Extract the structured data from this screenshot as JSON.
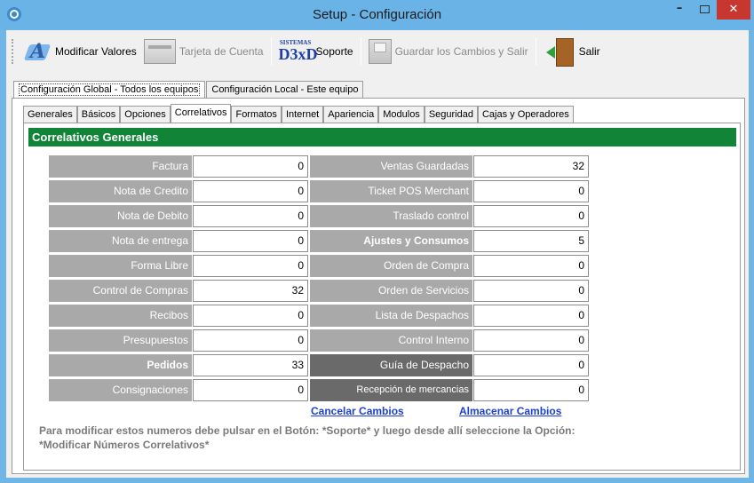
{
  "window": {
    "title": "Setup - Configuración",
    "controls": {
      "minimize": "–",
      "maximize": "",
      "close": "✕"
    }
  },
  "toolbar": {
    "modify_label": "Modificar Valores",
    "card_label": "Tarjeta de Cuenta",
    "support_logo_top": "SISTEMAS",
    "support_logo_main": "D3xD",
    "support_label": "Soporte",
    "save_label": "Guardar los Cambios  y Salir",
    "exit_label": "Salir"
  },
  "outer_tabs": [
    {
      "label": "Configuración Global - Todos los equipos",
      "active": true
    },
    {
      "label": "Configuración Local - Este equipo",
      "active": false
    }
  ],
  "inner_tabs": [
    {
      "label": "Generales",
      "active": false
    },
    {
      "label": "Básicos",
      "active": false
    },
    {
      "label": "Opciones",
      "active": false
    },
    {
      "label": "Correlativos",
      "active": true
    },
    {
      "label": "Formatos",
      "active": false
    },
    {
      "label": "Internet",
      "active": false
    },
    {
      "label": "Apariencia",
      "active": false
    },
    {
      "label": "Modulos",
      "active": false
    },
    {
      "label": "Seguridad",
      "active": false
    },
    {
      "label": "Cajas y Operadores",
      "active": false
    }
  ],
  "section": {
    "title": "Correlativos Generales"
  },
  "left_fields": [
    {
      "label": "Factura",
      "value": "0"
    },
    {
      "label": "Nota de Credito",
      "value": "0"
    },
    {
      "label": "Nota de Debito",
      "value": "0"
    },
    {
      "label": "Nota de entrega",
      "value": "0"
    },
    {
      "label": "Forma Libre",
      "value": "0"
    },
    {
      "label": "Control de Compras",
      "value": "32"
    },
    {
      "label": "Recibos",
      "value": "0"
    },
    {
      "label": "Presupuestos",
      "value": "0"
    },
    {
      "label": "Pedidos",
      "value": "33"
    },
    {
      "label": "Consignaciones",
      "value": "0"
    }
  ],
  "right_fields": [
    {
      "label": "Ventas Guardadas",
      "value": "32"
    },
    {
      "label": "Ticket POS Merchant",
      "value": "0"
    },
    {
      "label": "Traslado control",
      "value": "0"
    },
    {
      "label": "Ajustes y Consumos",
      "value": "5"
    },
    {
      "label": "Orden de Compra",
      "value": "0"
    },
    {
      "label": "Orden de Servicios",
      "value": "0"
    },
    {
      "label": "Lista de Despachos",
      "value": "0"
    },
    {
      "label": "Control Interno",
      "value": "0"
    },
    {
      "label": "Guía de Despacho",
      "value": "0"
    },
    {
      "label": "Recepción de mercancias",
      "value": "0"
    }
  ],
  "actions": {
    "cancel": "Cancelar Cambios",
    "store": "Almacenar Cambios"
  },
  "note": {
    "line1": "Para modificar estos numeros debe pulsar en el Botón: *Soporte* y luego desde allí seleccione la Opción:",
    "line2": "*Modificar Números Correlativos*"
  },
  "colors": {
    "titlebar": "#69b3e7",
    "section_header": "#118438",
    "label_bg": "#a9a9a9",
    "label_dark_bg": "#6a6a6a",
    "link": "#1b3fd6",
    "close_button": "#c7372f"
  }
}
